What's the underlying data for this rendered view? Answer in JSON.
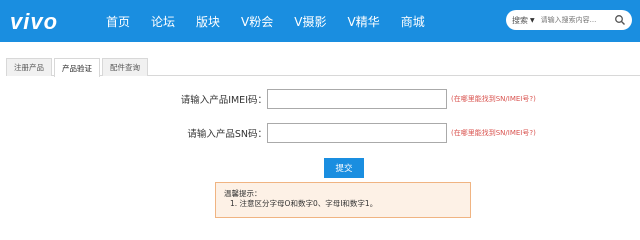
{
  "header": {
    "logo": "vivo",
    "nav": [
      "首页",
      "论坛",
      "版块",
      "V粉会",
      "V摄影",
      "V精华",
      "商城"
    ],
    "search": {
      "category": "搜索",
      "placeholder": "请输入搜索内容..."
    }
  },
  "tabs": [
    {
      "label": "注册产品",
      "active": false
    },
    {
      "label": "产品验证",
      "active": true
    },
    {
      "label": "配件查询",
      "active": false
    }
  ],
  "form": {
    "imei_label": "请输入产品IMEI码：",
    "imei_value": "",
    "imei_hint": "(在哪里能找到SN/IMEI号?)",
    "sn_label": "请输入产品SN码：",
    "sn_value": "",
    "sn_hint": "(在哪里能找到SN/IMEI号?)",
    "submit_label": "提交"
  },
  "notice": {
    "title": "温馨提示：",
    "items": [
      "1. 注意区分字母O和数字0、字母I和数字1。"
    ]
  },
  "colors": {
    "header_bg": "#1a8ee0",
    "hint": "#d9534f",
    "notice_bg": "#fdf1e6",
    "notice_border": "#f0b482"
  }
}
